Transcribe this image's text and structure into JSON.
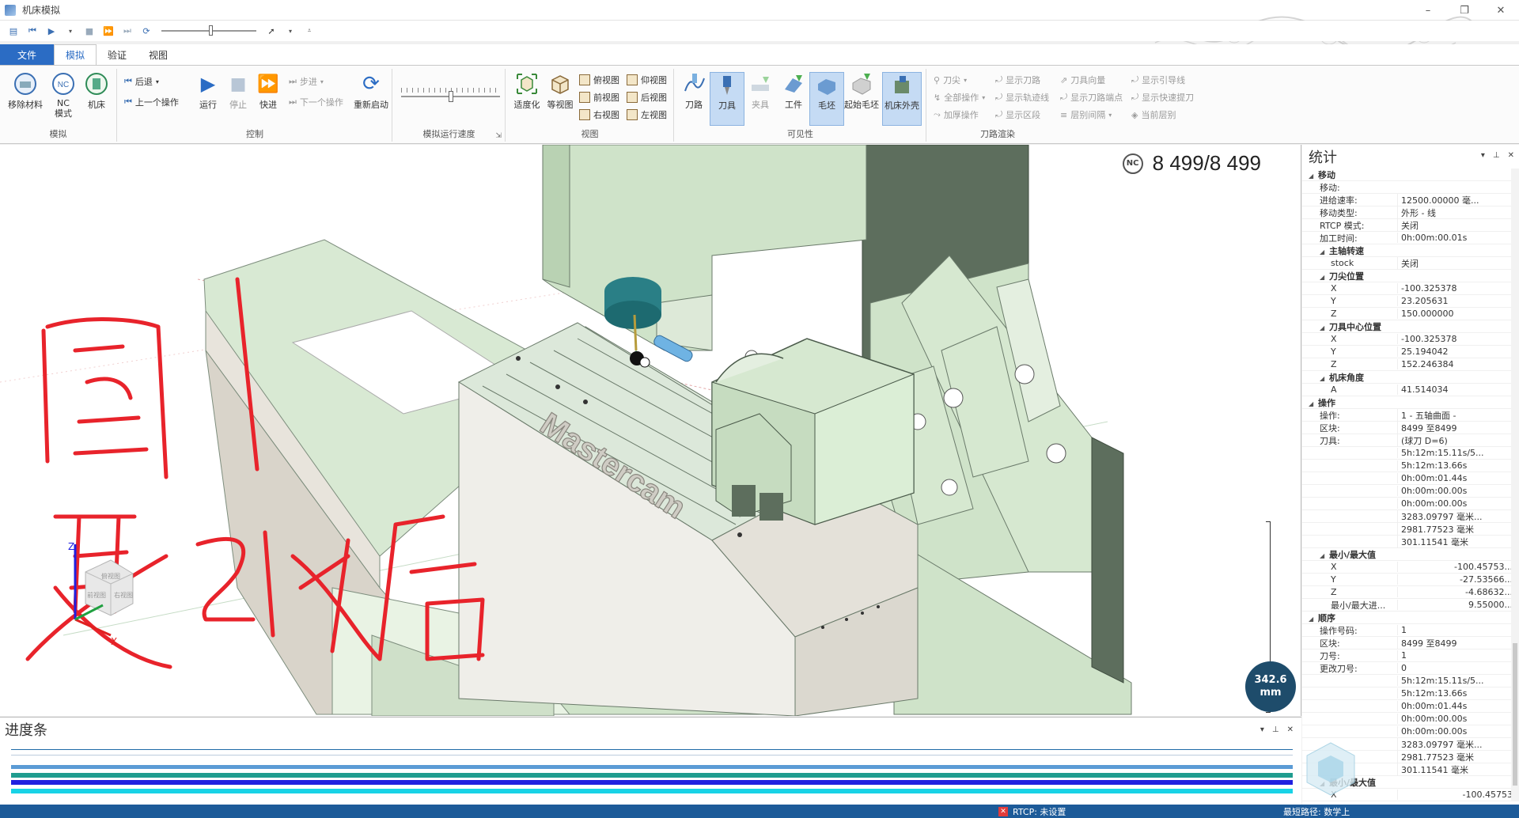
{
  "window": {
    "title": "机床模拟",
    "controls": [
      "–",
      "❐",
      "✕"
    ]
  },
  "ribbon_tabs": [
    "文件",
    "模拟",
    "验证",
    "视图"
  ],
  "ribbon": {
    "simulate": {
      "label": "模拟",
      "remove_material": "移除材料",
      "nc_mode": "NC\n模式",
      "machine": "机床"
    },
    "control": {
      "label": "控制",
      "back": "后退",
      "prev_op": "上一个操作",
      "run": "运行",
      "stop": "停止",
      "fast": "快进",
      "step": "步进",
      "next_op": "下一个操作",
      "restart": "重新启动"
    },
    "speed": {
      "label": "模拟运行速度"
    },
    "view": {
      "label": "视图",
      "fit": "适度化",
      "iso": "等视图",
      "top": "俯视图",
      "bottom": "仰视图",
      "front": "前视图",
      "back": "后视图",
      "right": "右视图",
      "left": "左视图"
    },
    "visibility": {
      "label": "可见性",
      "toolpath": "刀路",
      "tool": "刀具",
      "fixture": "夹具",
      "workpiece": "工件",
      "stock": "毛坯",
      "initial_stock": "起始毛坯",
      "housing": "机床外壳"
    },
    "toolpath_render": {
      "label": "刀路渲染",
      "tip": "刀尖",
      "all_ops": "全部操作",
      "add_op": "加厚操作",
      "show_toolpath": "显示刀路",
      "show_trace": "显示轨迹线",
      "show_range": "显示区段",
      "tool_vector": "刀具向量",
      "show_points": "显示刀路端点",
      "layer_spacing": "层别间隔",
      "show_leadin": "显示引导线",
      "show_rapid": "显示快速提刀",
      "current_layer": "当前层别"
    }
  },
  "viewport": {
    "nc_badge": "NC",
    "nc_count": "8 499/8 499",
    "scale_value": "342.6",
    "scale_unit": "mm",
    "brand_text": "Mastercam",
    "annotation_1": "图1",
    "annotation_2": "更改后",
    "cube_labels": {
      "top": "俯视图",
      "front": "前视图",
      "right": "右视图"
    },
    "axes": {
      "x": "X",
      "y": "Y",
      "z": "Z"
    }
  },
  "stats": {
    "title": "统计",
    "rows": [
      {
        "k": "移动",
        "v": "",
        "level": 0,
        "section": true
      },
      {
        "k": "移动:",
        "v": "",
        "level": 1
      },
      {
        "k": "进给速率:",
        "v": "12500.00000 毫...",
        "level": 1
      },
      {
        "k": "移动类型:",
        "v": "外形 - 线",
        "level": 1
      },
      {
        "k": "RTCP 模式:",
        "v": "关闭",
        "level": 1
      },
      {
        "k": "加工时间:",
        "v": "0h:00m:00.01s",
        "level": 1
      },
      {
        "k": "主轴转速",
        "v": "",
        "level": 1,
        "section": true
      },
      {
        "k": "stock",
        "v": "关闭",
        "level": 2
      },
      {
        "k": "刀尖位置",
        "v": "",
        "level": 1,
        "section": true
      },
      {
        "k": "X",
        "v": "-100.325378",
        "level": 2
      },
      {
        "k": "Y",
        "v": "23.205631",
        "level": 2
      },
      {
        "k": "Z",
        "v": "150.000000",
        "level": 2
      },
      {
        "k": "刀具中心位置",
        "v": "",
        "level": 1,
        "section": true
      },
      {
        "k": "X",
        "v": "-100.325378",
        "level": 2
      },
      {
        "k": "Y",
        "v": "25.194042",
        "level": 2
      },
      {
        "k": "Z",
        "v": "152.246384",
        "level": 2
      },
      {
        "k": "机床角度",
        "v": "",
        "level": 1,
        "section": true
      },
      {
        "k": "A",
        "v": "41.514034",
        "level": 2
      },
      {
        "k": "操作",
        "v": "",
        "level": 0,
        "section": true
      },
      {
        "k": "操作:",
        "v": "1 - 五轴曲面 -",
        "level": 1
      },
      {
        "k": "区块:",
        "v": "8499 至8499",
        "level": 1
      },
      {
        "k": "刀具:",
        "v": "(球刀 D=6)",
        "level": 1
      },
      {
        "k": "",
        "v": "5h:12m:15.11s/5...",
        "level": 1
      },
      {
        "k": "",
        "v": "5h:12m:13.66s",
        "level": 1
      },
      {
        "k": "",
        "v": "0h:00m:01.44s",
        "level": 1
      },
      {
        "k": "",
        "v": "0h:00m:00.00s",
        "level": 1
      },
      {
        "k": "",
        "v": "0h:00m:00.00s",
        "level": 1
      },
      {
        "k": "",
        "v": "3283.09797 毫米...",
        "level": 1
      },
      {
        "k": "",
        "v": "2981.77523 毫米",
        "level": 1
      },
      {
        "k": "",
        "v": "301.11541 毫米",
        "level": 1
      },
      {
        "k": "最小/最大值",
        "v": "",
        "level": 1,
        "section": true
      },
      {
        "k": "X",
        "v": "-100.45753...",
        "level": 2,
        "right": true
      },
      {
        "k": "Y",
        "v": "-27.53566...",
        "level": 2,
        "right": true
      },
      {
        "k": "Z",
        "v": "-4.68632...",
        "level": 2,
        "right": true
      },
      {
        "k": "最小/最大进...",
        "v": "9.55000...",
        "level": 2,
        "right": true
      },
      {
        "k": "顺序",
        "v": "",
        "level": 0,
        "section": true
      },
      {
        "k": "操作号码:",
        "v": "1",
        "level": 1
      },
      {
        "k": "区块:",
        "v": "8499 至8499",
        "level": 1
      },
      {
        "k": "刀号:",
        "v": "1",
        "level": 1
      },
      {
        "k": "更改刀号:",
        "v": "0",
        "level": 1
      },
      {
        "k": "",
        "v": "5h:12m:15.11s/5...",
        "level": 1
      },
      {
        "k": "",
        "v": "5h:12m:13.66s",
        "level": 1
      },
      {
        "k": "",
        "v": "0h:00m:01.44s",
        "level": 1
      },
      {
        "k": "",
        "v": "0h:00m:00.00s",
        "level": 1
      },
      {
        "k": "",
        "v": "0h:00m:00.00s",
        "level": 1
      },
      {
        "k": "",
        "v": "3283.09797 毫米...",
        "level": 1
      },
      {
        "k": "",
        "v": "2981.77523 毫米",
        "level": 1
      },
      {
        "k": "",
        "v": "301.11541 毫米",
        "level": 1
      },
      {
        "k": "最小/最大值",
        "v": "",
        "level": 1,
        "section": true
      },
      {
        "k": "X",
        "v": "-100.45753",
        "level": 2,
        "right": true
      }
    ]
  },
  "progress": {
    "title": "进度条",
    "fraction": 1.0,
    "bars": [
      {
        "color": "#5b9bd5"
      },
      {
        "color": "#1f9c8f"
      },
      {
        "color": "#2020e0"
      },
      {
        "color": "#18d3e6"
      }
    ]
  },
  "status": {
    "rtcp": "RTCP: 未设置",
    "path": "最短路径: 数学上"
  },
  "colors": {
    "accent": "#2b6cc4",
    "statusbar": "#1d5b99",
    "machine_green": "#d4e8d0",
    "machine_dark": "#5d6e5d",
    "annotation_red": "#e8232b"
  }
}
